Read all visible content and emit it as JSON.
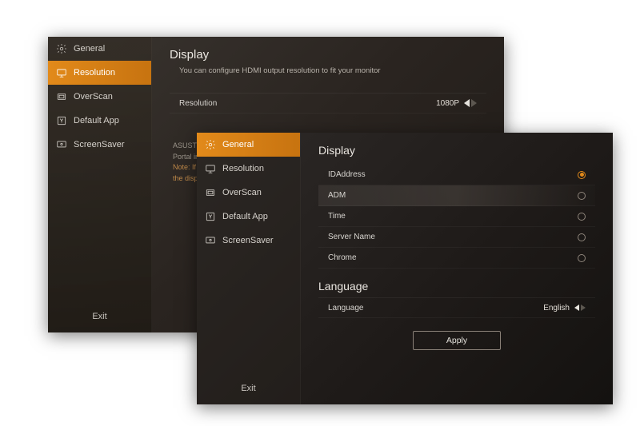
{
  "back": {
    "sidebar": {
      "items": [
        {
          "label": "General"
        },
        {
          "label": "Resolution"
        },
        {
          "label": "OverScan"
        },
        {
          "label": "Default App"
        },
        {
          "label": "ScreenSaver"
        }
      ],
      "selected_index": 1,
      "exit_label": "Exit"
    },
    "section_title": "Display",
    "subtext": "You can configure  HDMI output resolution to  fit your monitor",
    "resolution_row": {
      "label": "Resolution",
      "value": "1080P"
    },
    "note_line1": "ASUSTOR",
    "note_line2": "Portal inte",
    "note_line3": "Note: If th",
    "note_line4": "the displa"
  },
  "front": {
    "sidebar": {
      "items": [
        {
          "label": "General"
        },
        {
          "label": "Resolution"
        },
        {
          "label": "OverScan"
        },
        {
          "label": "Default App"
        },
        {
          "label": "ScreenSaver"
        }
      ],
      "selected_index": 0,
      "exit_label": "Exit"
    },
    "display_section_title": "Display",
    "display_items": [
      {
        "label": "IDAddress",
        "selected": true
      },
      {
        "label": "ADM",
        "selected": false,
        "highlight": true
      },
      {
        "label": "Time",
        "selected": false
      },
      {
        "label": "Server Name",
        "selected": false
      },
      {
        "label": "Chrome",
        "selected": false
      }
    ],
    "language_section_title": "Language",
    "language_row": {
      "label": "Language",
      "value": "English"
    },
    "apply_label": "Apply"
  }
}
